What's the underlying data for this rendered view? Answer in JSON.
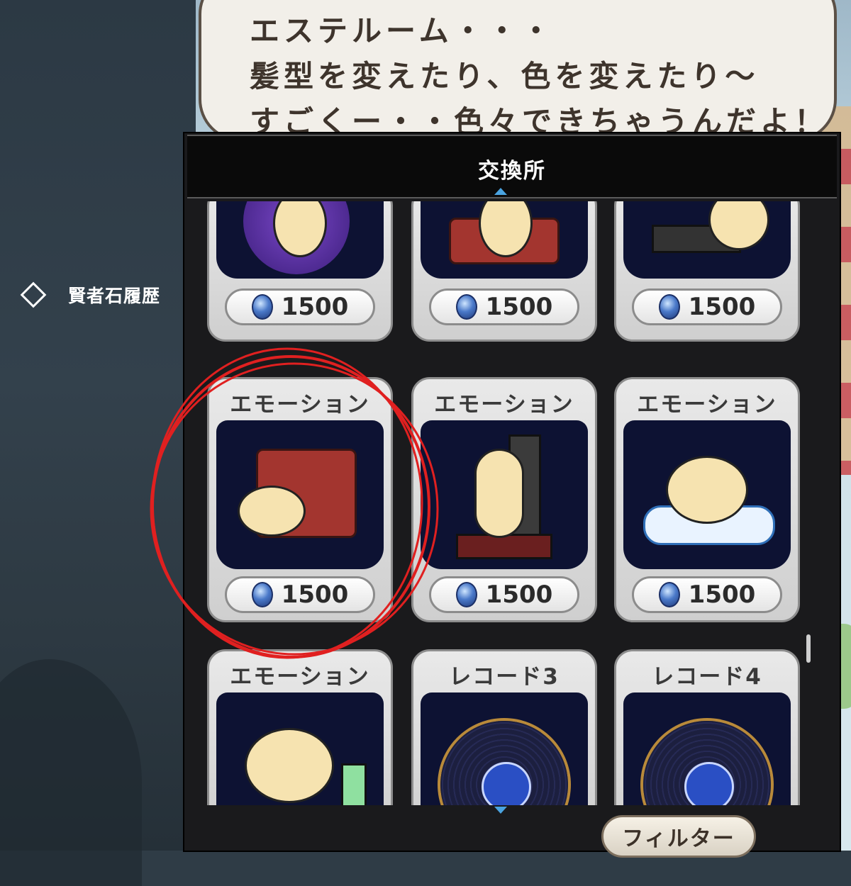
{
  "sidebar": {
    "item_label": "賢者石履歴"
  },
  "speech": {
    "text": "エステルーム・・・\n髪型を変えたり、色を変えたり〜\nすごくー・・色々できちゃうんだよ！"
  },
  "panel": {
    "title": "交換所"
  },
  "items": [
    {
      "title": "",
      "price": "1500",
      "icon": "purple-magic-emote-icon"
    },
    {
      "title": "",
      "price": "1500",
      "icon": "red-box-emote-icon"
    },
    {
      "title": "",
      "price": "1500",
      "icon": "bbq-grill-emote-icon"
    },
    {
      "title": "エモーション",
      "price": "1500",
      "icon": "mimic-chest-emote-icon"
    },
    {
      "title": "エモーション",
      "price": "1500",
      "icon": "door-stand-emote-icon"
    },
    {
      "title": "エモーション",
      "price": "1500",
      "icon": "wave-swim-emote-icon"
    },
    {
      "title": "エモーション",
      "price": "",
      "icon": "snack-lounge-emote-icon"
    },
    {
      "title": "レコード3",
      "price": "",
      "icon": "record-disc-icon"
    },
    {
      "title": "レコード4",
      "price": "",
      "icon": "record-disc-icon"
    }
  ],
  "filter": {
    "label": "フィルター"
  },
  "colors": {
    "annotation": "#e02020",
    "accent": "#4aa3e0",
    "panel": "#1a1a1c"
  }
}
